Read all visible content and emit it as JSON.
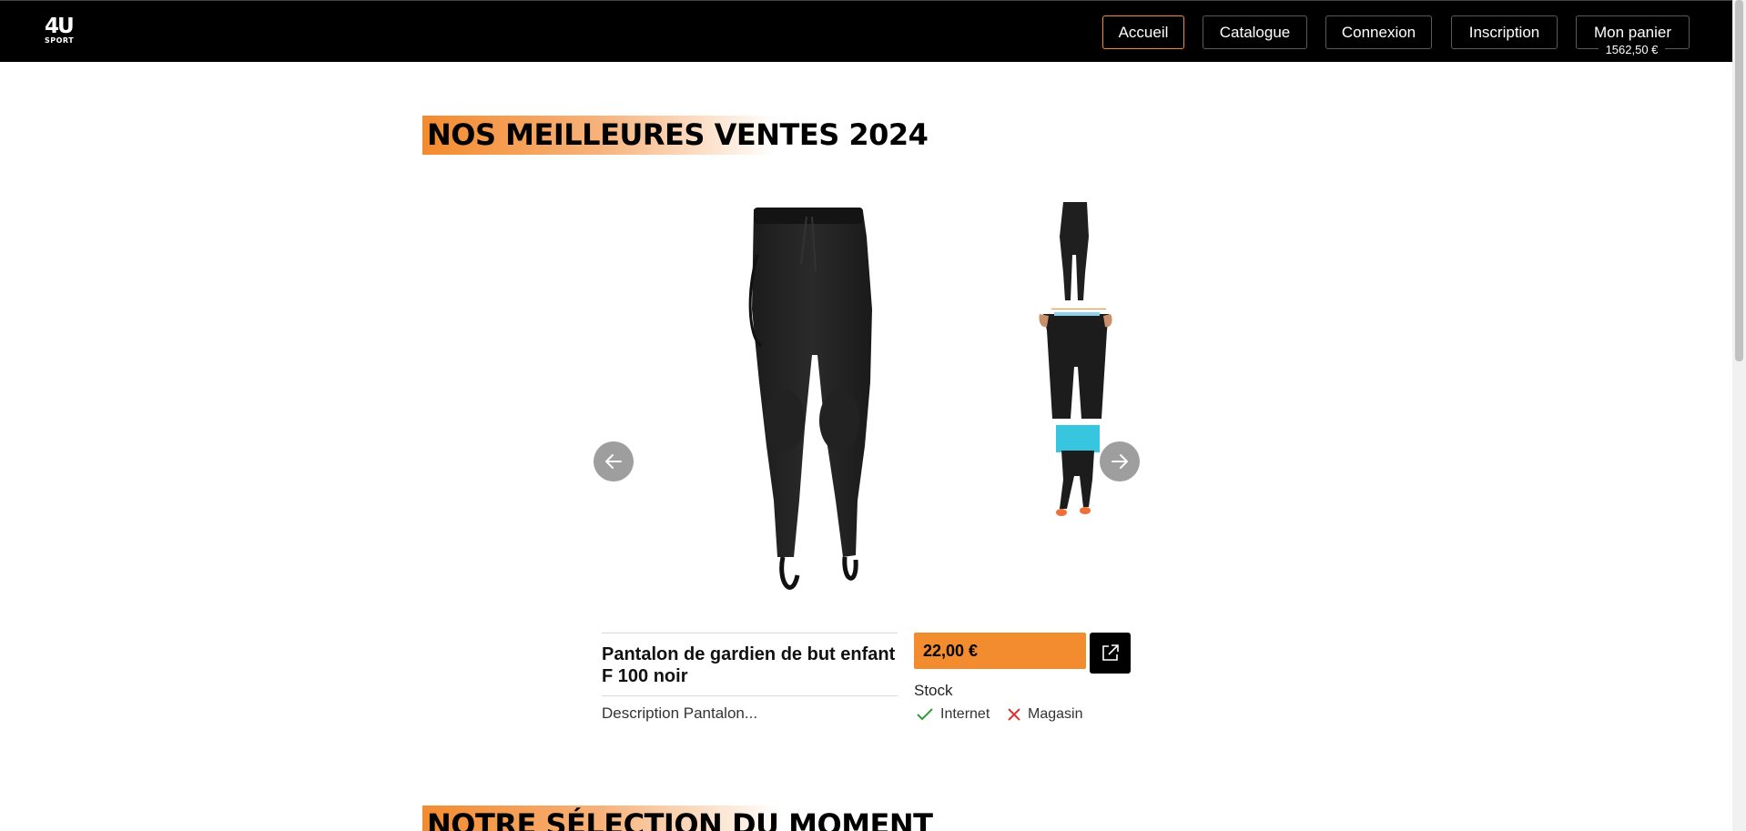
{
  "brand": {
    "logo_line1": "4U",
    "logo_line2": "SPORT"
  },
  "nav": {
    "items": [
      {
        "label": "Accueil",
        "active": true
      },
      {
        "label": "Catalogue",
        "active": false
      },
      {
        "label": "Connexion",
        "active": false
      },
      {
        "label": "Inscription",
        "active": false
      },
      {
        "label": "Mon panier",
        "active": false
      }
    ],
    "cart_total": "1562,50 €"
  },
  "sections": {
    "bestsellers_title": "NOS MEILLEURES VENTES 2024",
    "selection_title": "NOTRE SÉLECTION DU MOMENT"
  },
  "product": {
    "name": "Pantalon de gardien de but enfant F 100 noir",
    "description": "Description Pantalon...",
    "price": "22,00 €",
    "stock_label": "Stock",
    "availability": [
      {
        "channel": "Internet",
        "available": true,
        "icon": "check-icon"
      },
      {
        "channel": "Magasin",
        "available": false,
        "icon": "cross-icon"
      }
    ]
  },
  "colors": {
    "accent": "#f38b2f",
    "available": "#2e9e3c",
    "unavailable": "#e03131",
    "arrow_bg": "#9e9e9e"
  },
  "icons": {
    "prev": "arrow-left-icon",
    "next": "arrow-right-icon",
    "open": "external-link-icon"
  }
}
